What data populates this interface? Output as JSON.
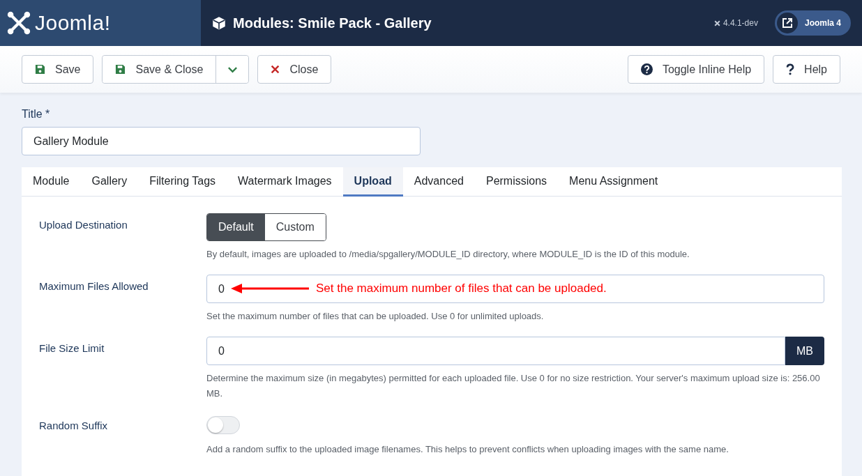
{
  "header": {
    "logo_text": "Joomla!",
    "title": "Modules: Smile Pack - Gallery",
    "version": "4.4.1-dev",
    "site_button": "Joomla 4"
  },
  "toolbar": {
    "left": [
      {
        "kind": "save",
        "label": "Save"
      },
      {
        "kind": "save-close",
        "label": "Save & Close",
        "dropdown": true
      },
      {
        "kind": "close",
        "label": "Close"
      }
    ],
    "right": [
      {
        "kind": "inline-help",
        "label": "Toggle Inline Help"
      },
      {
        "kind": "help",
        "label": "Help"
      }
    ]
  },
  "title_field": {
    "label": "Title *",
    "value": "Gallery Module"
  },
  "tabs": [
    {
      "label": "Module",
      "selected": false
    },
    {
      "label": "Gallery",
      "selected": false
    },
    {
      "label": "Filtering Tags",
      "selected": false
    },
    {
      "label": "Watermark Images",
      "selected": false
    },
    {
      "label": "Upload",
      "selected": true
    },
    {
      "label": "Advanced",
      "selected": false
    },
    {
      "label": "Permissions",
      "selected": false
    },
    {
      "label": "Menu Assignment",
      "selected": false
    }
  ],
  "fields": [
    {
      "kind": "segmented",
      "label": "Upload Destination",
      "options": [
        {
          "label": "Default",
          "selected": true
        },
        {
          "label": "Custom",
          "selected": false
        }
      ],
      "description": "By default, images are uploaded to /media/spgallery/MODULE_ID directory, where MODULE_ID is the ID of this module."
    },
    {
      "kind": "text",
      "label": "Maximum Files Allowed",
      "value": "0",
      "annotation": "Set the maximum number of files that can be uploaded.",
      "description": "Set the maximum number of files that can be uploaded. Use 0 for unlimited uploads."
    },
    {
      "kind": "addon",
      "label": "File Size Limit",
      "value": "0",
      "addon": "MB",
      "description": "Determine the maximum size (in megabytes) permitted for each uploaded file. Use 0 for no size restriction. Your server's maximum upload size is: 256.00 MB."
    },
    {
      "kind": "toggle",
      "label": "Random Suffix",
      "on": false,
      "description": "Add a random suffix to the uploaded image filenames. This helps to prevent conflicts when uploading images with the same name."
    }
  ]
}
